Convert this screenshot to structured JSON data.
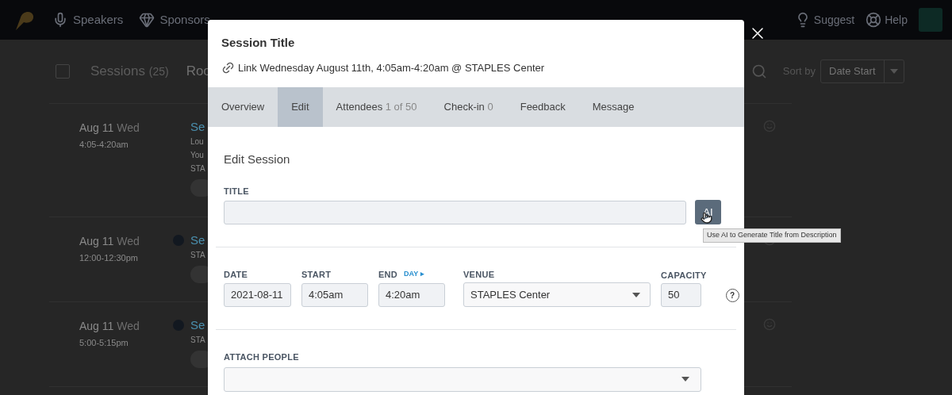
{
  "nav": {
    "left": [
      {
        "label": "Speakers",
        "kind": "mic"
      },
      {
        "label": "Sponsors",
        "kind": "diamond"
      }
    ],
    "right": [
      {
        "label": "Suggest",
        "kind": "bulb"
      },
      {
        "label": "Help",
        "kind": "lifebuoy"
      }
    ]
  },
  "list_header": {
    "checked": false,
    "title": "Sessions",
    "count": "(25)",
    "tab_2": "Roo",
    "sort_label": "Sort by",
    "sort_value": "Date Start"
  },
  "rows": [
    {
      "date": "Aug 11",
      "weekday": "Wed",
      "time": "4:05-4:20am",
      "dot": false,
      "lines": [
        "Se",
        "Lou",
        "You",
        "STA"
      ]
    },
    {
      "date": "Aug 11",
      "weekday": "Wed",
      "time": "12:00-12:30pm",
      "dot": true,
      "lines": [
        "Se",
        "STA"
      ]
    },
    {
      "date": "Aug 11",
      "weekday": "Wed",
      "time": "5:00-5:15pm",
      "dot": true,
      "lines": [
        "Se",
        "STA"
      ]
    }
  ],
  "modal": {
    "title": "Session Title",
    "subtitle": "Link Wednesday August 11th, 4:05am-4:20am @ STAPLES Center",
    "tabs": [
      {
        "label": "Overview",
        "selected": false
      },
      {
        "label": "Edit",
        "selected": true
      },
      {
        "label": "Attendees",
        "count": "1 of 50",
        "selected": false
      },
      {
        "label": "Check-in",
        "count": "0",
        "selected": false
      },
      {
        "label": "Feedback",
        "selected": false
      },
      {
        "label": "Message",
        "selected": false
      }
    ],
    "heading": "Edit Session",
    "title_label": "TITLE",
    "ai_button": "AI",
    "tooltip": "Use AI to Generate Title from Description",
    "date": {
      "label": "DATE",
      "value": "2021-08-11"
    },
    "start": {
      "label": "START",
      "value": "4:05am"
    },
    "end": {
      "label": "END",
      "link": "DAY ▸",
      "value": "4:20am"
    },
    "venue": {
      "label": "VENUE",
      "value": "STAPLES Center"
    },
    "capacity": {
      "label": "CAPACITY",
      "value": "50"
    },
    "help": "?",
    "people_label": "ATTACH PEOPLE"
  }
}
